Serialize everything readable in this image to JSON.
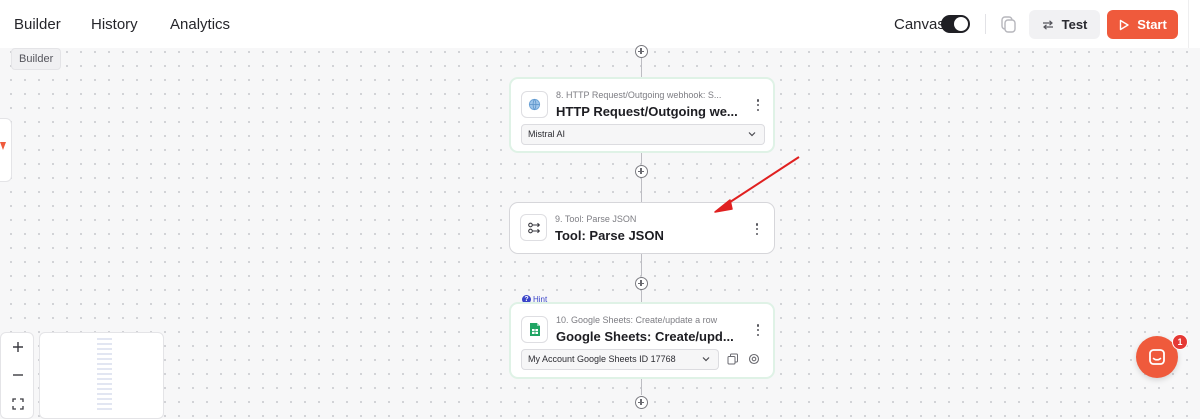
{
  "topbar": {
    "tabs": [
      {
        "label": "Builder"
      },
      {
        "label": "History"
      },
      {
        "label": "Analytics"
      }
    ],
    "canvas_label": "Canvas",
    "canvas_toggle_on": true,
    "test_label": "Test",
    "start_label": "Start"
  },
  "breadcrumb_chip": "Builder",
  "nodes": [
    {
      "subtitle": "8. HTTP Request/Outgoing webhook: S...",
      "title": "HTTP Request/Outgoing we...",
      "select_value": "Mistral AI",
      "icon": "globe-icon"
    },
    {
      "subtitle": "9. Tool: Parse JSON",
      "title": "Tool: Parse JSON",
      "icon": "parse-json-icon"
    },
    {
      "hint": "Hint",
      "subtitle": "10. Google Sheets: Create/update a row",
      "title": "Google Sheets: Create/upd...",
      "select_value": "My Account Google Sheets ID 17768",
      "icon": "google-sheets-icon"
    }
  ],
  "chat_badge_count": "1",
  "colors": {
    "accent": "#ef5a3c",
    "hint": "#3a44c9",
    "annotation_arrow": "#e02020"
  }
}
